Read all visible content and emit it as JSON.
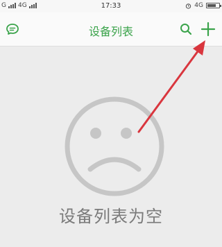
{
  "status_bar": {
    "sim1_label": "G",
    "network_label": "4G",
    "time": "17:33",
    "right_network": "4G"
  },
  "header": {
    "title": "设备列表"
  },
  "empty_state": {
    "message": "设备列表为空"
  },
  "colors": {
    "accent": "#3aa34a",
    "annotation_arrow": "#d9363e"
  },
  "icons": [
    "chat-bubble-icon",
    "search-icon",
    "plus-icon",
    "sad-face-icon",
    "alarm-icon",
    "battery-icon",
    "signal-icon"
  ]
}
